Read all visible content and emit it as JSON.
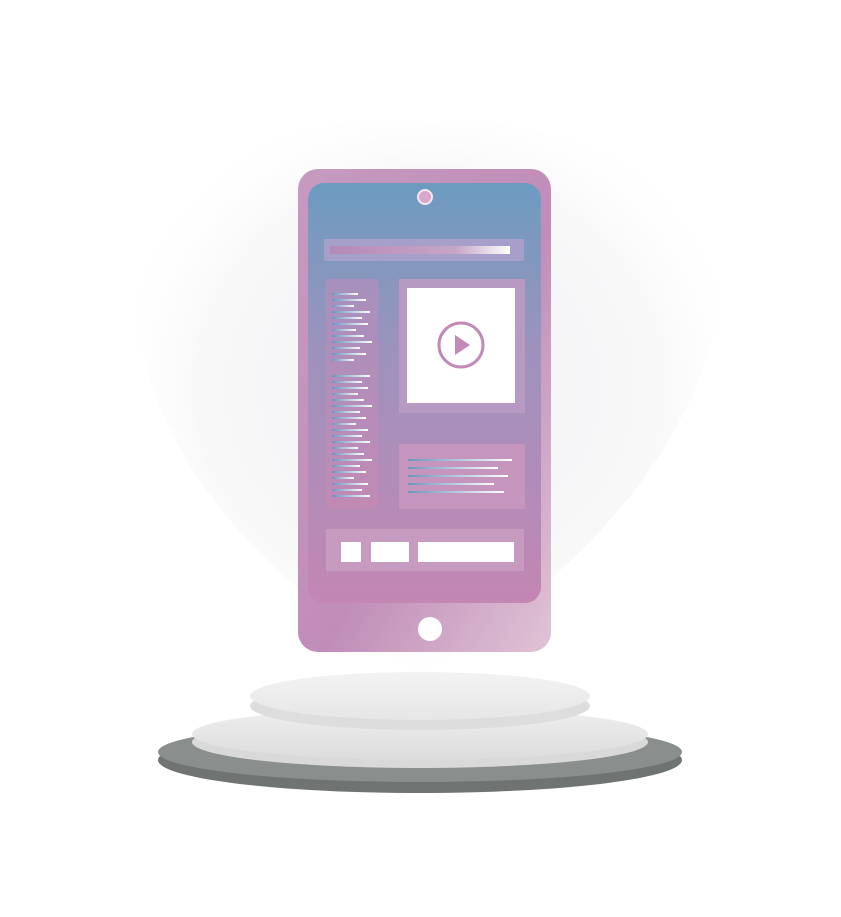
{
  "scene": {
    "background_color": "#ffffff",
    "glow_color": "#f2f2f4"
  },
  "phone": {
    "body_gradient": [
      "#c89abd",
      "#d7b3cb",
      "#b989b2"
    ],
    "screen_gradient_top": "#6d9bbf",
    "screen_gradient_bottom": "#c287b4",
    "camera_icon": "camera-dot-icon",
    "home_button_icon": "home-button-icon",
    "screen": {
      "header_bar": "header-bar",
      "sidebar_text_block": "sidebar-text-lines",
      "video_player": {
        "icon": "play-icon",
        "background": "#ffffff"
      },
      "caption_text_block": "caption-text-lines",
      "footer_buttons": [
        "small-square-button",
        "medium-button",
        "wide-button"
      ]
    }
  },
  "podium": {
    "top_tier_color": "#f0f0f0",
    "middle_tier_color": "#e8e8e8",
    "base_color": "#878b89",
    "base_shadow_color": "#6f7472"
  }
}
